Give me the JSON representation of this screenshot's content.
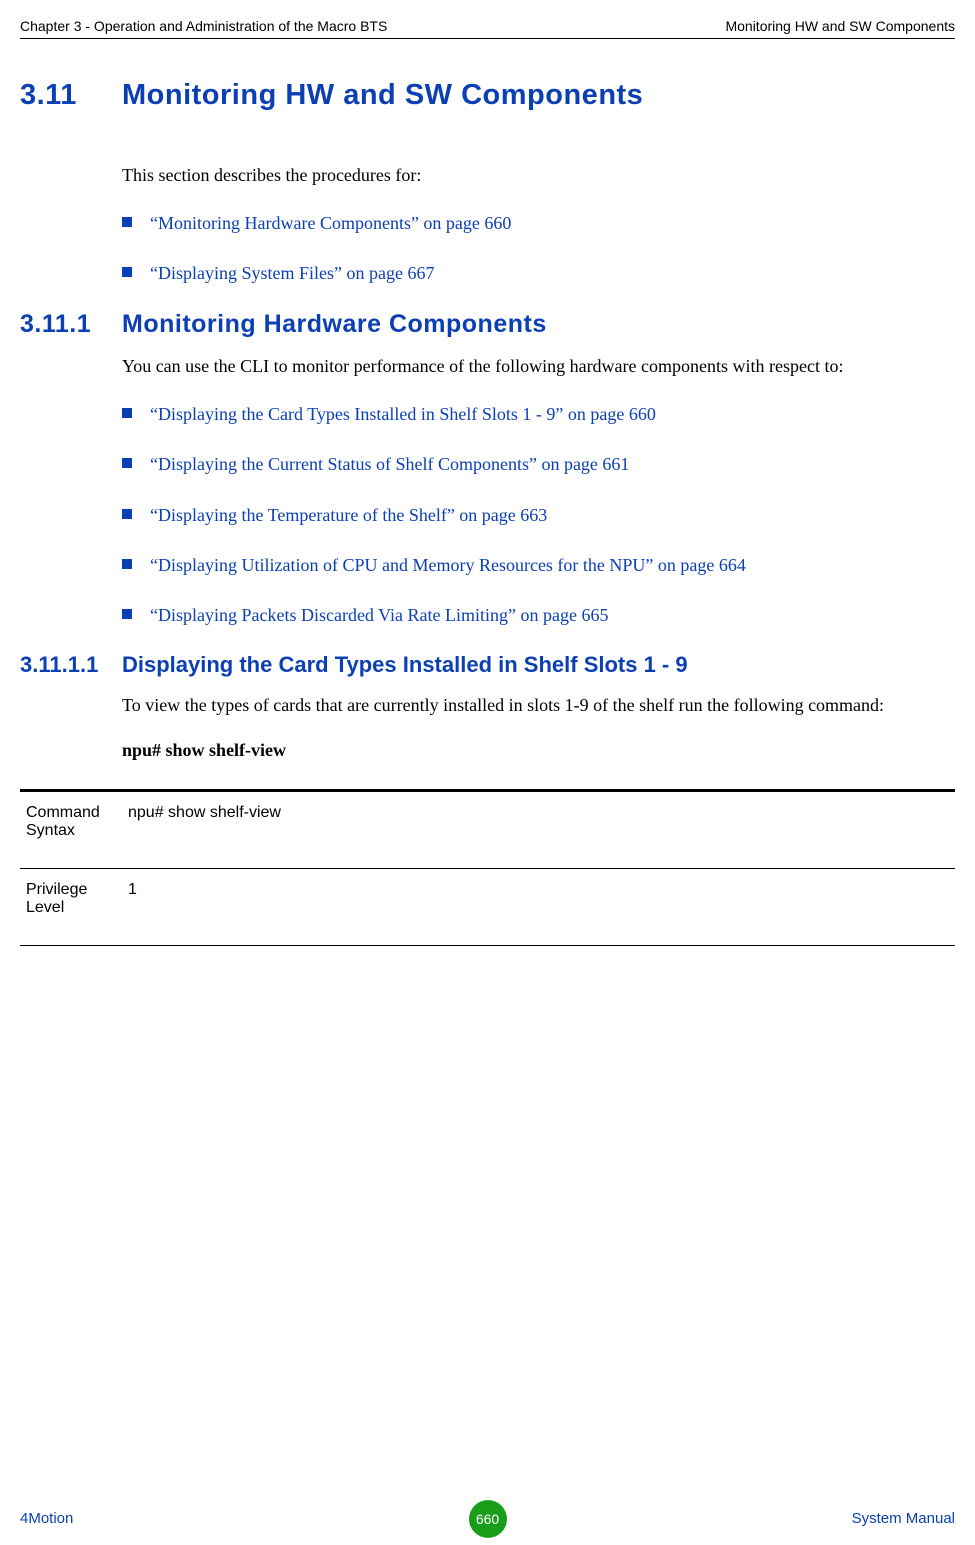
{
  "header": {
    "left": "Chapter 3 - Operation and Administration of the Macro BTS",
    "right": "Monitoring HW and SW Components"
  },
  "section": {
    "num": "3.11",
    "title": "Monitoring HW and SW Components",
    "intro": "This section describes the procedures for:",
    "bullets": [
      "“Monitoring Hardware Components” on page 660",
      "“Displaying System Files” on page 667"
    ]
  },
  "subsection": {
    "num": "3.11.1",
    "title": "Monitoring Hardware Components",
    "intro": "You can use the CLI to monitor performance of the following hardware components with respect to:",
    "bullets": [
      "“Displaying the Card Types Installed in Shelf Slots 1 - 9” on page 660",
      "“Displaying the Current Status of Shelf Components” on page 661",
      "“Displaying the Temperature of the Shelf” on page 663",
      "“Displaying Utilization of CPU and Memory Resources for the NPU” on page 664",
      "“Displaying Packets Discarded Via Rate Limiting” on page 665"
    ]
  },
  "subsub": {
    "num": "3.11.1.1",
    "title": "Displaying the Card Types Installed in Shelf Slots 1 - 9",
    "intro": "To view the types of cards that are currently installed in slots 1-9 of the shelf run the following command:",
    "command": "npu# show shelf-view"
  },
  "table": {
    "row1_label": "Command Syntax",
    "row1_value": "npu# show shelf-view",
    "row2_label": "Privilege Level",
    "row2_value": "1"
  },
  "footer": {
    "left": "4Motion",
    "page": "660",
    "right": "System Manual"
  }
}
